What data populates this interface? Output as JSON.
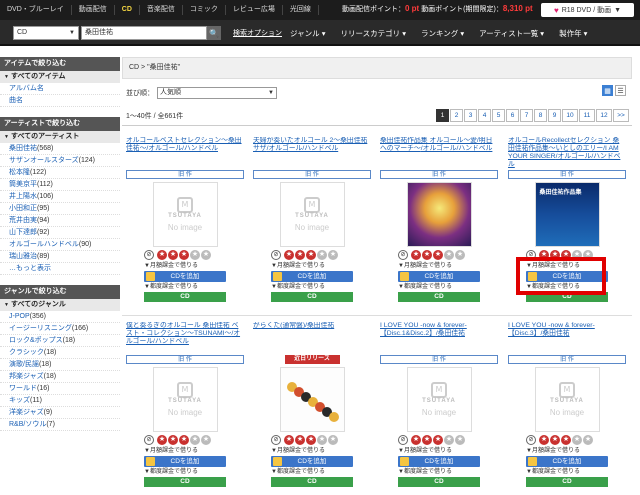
{
  "topnav": [
    "DVD・ブルーレイ",
    "動画配信",
    "CD",
    "音楽配信",
    "コミック",
    "レビュー広場",
    "光回線"
  ],
  "topnav_active": 2,
  "points": {
    "label1": "動画配信ポイント：",
    "val1": "0 pt",
    "label2": "動画ポイント(期間限定)：",
    "val2": "8,310 pt"
  },
  "r18_label": "R18 DVD / 動画",
  "search": {
    "category": "CD",
    "query": "桑田佳祐",
    "option": "検索オプション"
  },
  "mainnav": [
    "ジャンル",
    "リリースカテゴリ",
    "ランキング",
    "アーティスト一覧",
    "製作年"
  ],
  "sidebar": {
    "items_head": "アイテムで絞り込む",
    "items_all": "すべてのアイテム",
    "items": [
      "アルバム名",
      "曲名"
    ],
    "artist_head": "アーティストで絞り込む",
    "artist_all": "すべてのアーティスト",
    "artists": [
      {
        "name": "桑田佳祐",
        "count": "(568)"
      },
      {
        "name": "サザンオールスターズ",
        "count": "(124)"
      },
      {
        "name": "松本隆",
        "count": "(122)"
      },
      {
        "name": "筒美京平",
        "count": "(112)"
      },
      {
        "name": "井上陽水",
        "count": "(106)"
      },
      {
        "name": "小田和正",
        "count": "(95)"
      },
      {
        "name": "荒井由実",
        "count": "(94)"
      },
      {
        "name": "山下達郎",
        "count": "(92)"
      },
      {
        "name": "オルゴールハンドベル",
        "count": "(90)"
      },
      {
        "name": "瑞山雅治",
        "count": "(89)"
      }
    ],
    "more": "…もっと表示",
    "genre_head": "ジャンルで絞り込む",
    "genre_all": "すべてのジャンル",
    "genres": [
      {
        "name": "J-POP",
        "count": "(356)"
      },
      {
        "name": "イージーリスニング",
        "count": "(166)"
      },
      {
        "name": "ロック&ポップス",
        "count": "(18)"
      },
      {
        "name": "クラシック",
        "count": "(18)"
      },
      {
        "name": "演歌/民謡",
        "count": "(18)"
      },
      {
        "name": "邦楽ジャズ",
        "count": "(18)"
      },
      {
        "name": "ワールド",
        "count": "(16)"
      },
      {
        "name": "キッズ",
        "count": "(11)"
      },
      {
        "name": "洋楽ジャズ",
        "count": "(9)"
      },
      {
        "name": "R&B/ソウル",
        "count": "(7)"
      }
    ]
  },
  "breadcrumb": "CD > \"桑田佳祐\"",
  "sort": {
    "label": "並び順：",
    "value": "人気順"
  },
  "count_text": "1〜40件 / 全661件",
  "pager": [
    "1",
    "2",
    "3",
    "4",
    "5",
    "6",
    "7",
    "8",
    "9",
    "10",
    "11",
    "12",
    ">>"
  ],
  "pager_current": 0,
  "labels": {
    "tag": "旧 作",
    "release": "近日リリース",
    "rental": "▼月額課金で借りる",
    "rental2": "▼都度課金で借りる",
    "add": "CDを追加",
    "cd": "CD",
    "noimage": "No image",
    "tsutaya": "TSUTAYA",
    "sleeve": "桑田佳祐作品集"
  },
  "products": [
    {
      "title": "オルゴールベストセレクション〜桑田佳祐〜",
      "artist": "/オルゴール/ハンドベル",
      "img": "noimg",
      "stars": 3,
      "release": false
    },
    {
      "title": "夫婦が奏いたオルゴール 2〜桑田佳祐サザ",
      "artist": "/オルゴール/ハンドベル",
      "img": "noimg",
      "stars": 3,
      "release": false
    },
    {
      "title": "桑田佳祐作品集 オルゴール〜愛/明日へのマーチ〜",
      "artist": "/オルゴール/ハンドベル",
      "img": "fest",
      "stars": 3,
      "release": false
    },
    {
      "title": "オルゴールRecollectセレクション 桑田佳祐作品集〜いとしのエリー/I AM YOUR SINGER",
      "artist": "/オルゴール/ハンドベル",
      "img": "blue",
      "stars": 3,
      "release": false
    },
    {
      "title": "僕と奏るぎのオルゴール 桑田佳祐 ベスト・コレクション〜TSUNAMI〜",
      "artist": "/オルゴール/ハンドベル",
      "img": "noimg",
      "stars": 3,
      "release": false
    },
    {
      "title": "がらくた(通常盤)",
      "artist": "/桑田佳祐",
      "img": "orgel",
      "stars": 3,
      "release": true
    },
    {
      "title": "I LOVE YOU -now & forever-【Disc.1&Disc.2】",
      "artist": "/桑田佳祐",
      "img": "noimg",
      "stars": 3,
      "release": false
    },
    {
      "title": "I LOVE YOU -now & forever-【Disc.3】",
      "artist": "/桑田佳祐",
      "img": "noimg",
      "stars": 3,
      "release": false
    }
  ]
}
